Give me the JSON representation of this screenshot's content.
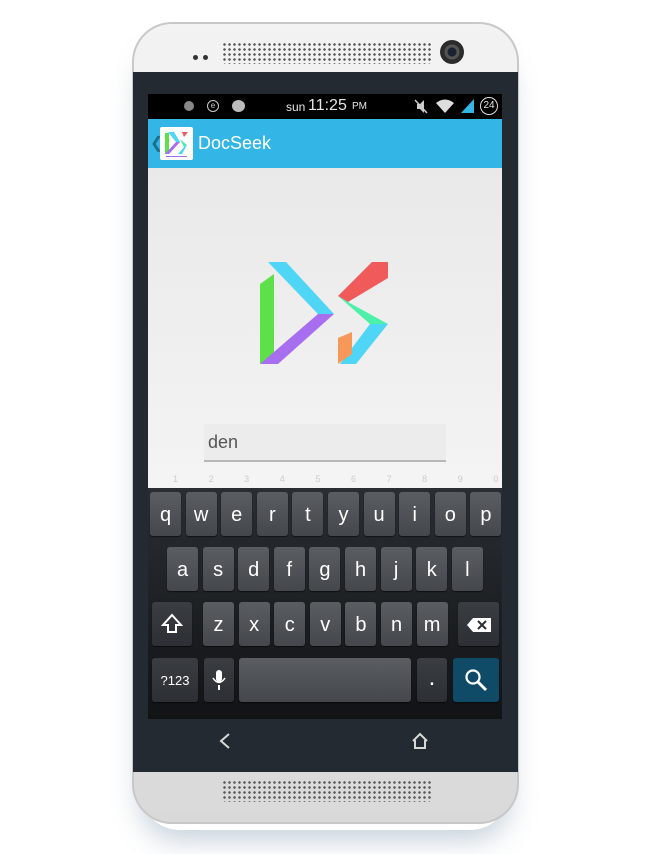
{
  "status_bar": {
    "day": "sun",
    "time": "11:25",
    "ampm": "PM",
    "battery": "24"
  },
  "action_bar": {
    "title": "DocSeek"
  },
  "search": {
    "value": "den"
  },
  "keyboard": {
    "row1": [
      {
        "label": "q",
        "hint": "1"
      },
      {
        "label": "w",
        "hint": "2"
      },
      {
        "label": "e",
        "hint": "3"
      },
      {
        "label": "r",
        "hint": "4"
      },
      {
        "label": "t",
        "hint": "5"
      },
      {
        "label": "y",
        "hint": "6"
      },
      {
        "label": "u",
        "hint": "7"
      },
      {
        "label": "i",
        "hint": "8"
      },
      {
        "label": "o",
        "hint": "9"
      },
      {
        "label": "p",
        "hint": "0"
      }
    ],
    "row2": [
      "a",
      "s",
      "d",
      "f",
      "g",
      "h",
      "j",
      "k",
      "l"
    ],
    "row3": [
      "z",
      "x",
      "c",
      "v",
      "b",
      "n",
      "m"
    ],
    "symbols_label": "?123",
    "period_label": "."
  },
  "icons": {
    "shift": "shift-icon",
    "backspace": "backspace-icon",
    "mic": "microphone-icon",
    "search": "search-icon",
    "back": "back-icon",
    "home": "home-icon"
  },
  "colors": {
    "action_bar": "#33b5e5",
    "logo_cyan": "#4fd5f5",
    "logo_green": "#5ee04a",
    "logo_purple": "#a86ef0",
    "logo_red": "#f05a5a",
    "logo_mint": "#4df0a8",
    "logo_orange": "#f5985a"
  }
}
